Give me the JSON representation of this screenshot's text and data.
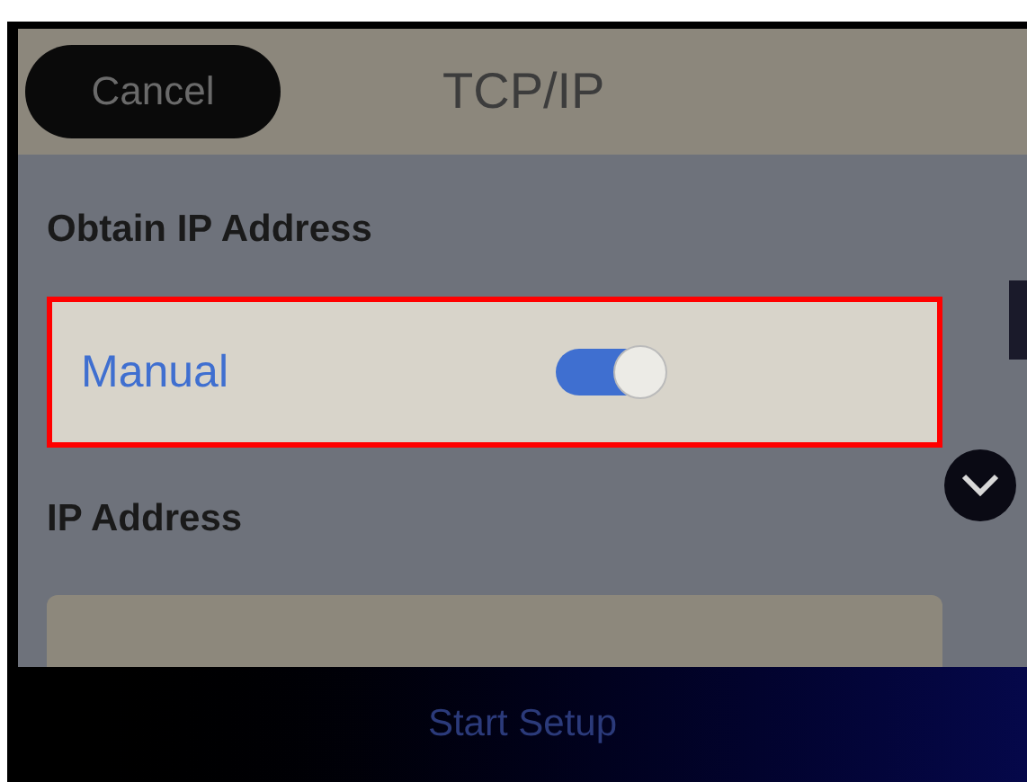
{
  "header": {
    "cancel_button": "Cancel",
    "title": "TCP/IP"
  },
  "obtain_ip": {
    "label": "Obtain IP Address",
    "option": {
      "label": "Manual",
      "on": true,
      "highlighted": true
    }
  },
  "ip_address": {
    "label": "IP Address"
  },
  "footer": {
    "button": "Start Setup"
  }
}
